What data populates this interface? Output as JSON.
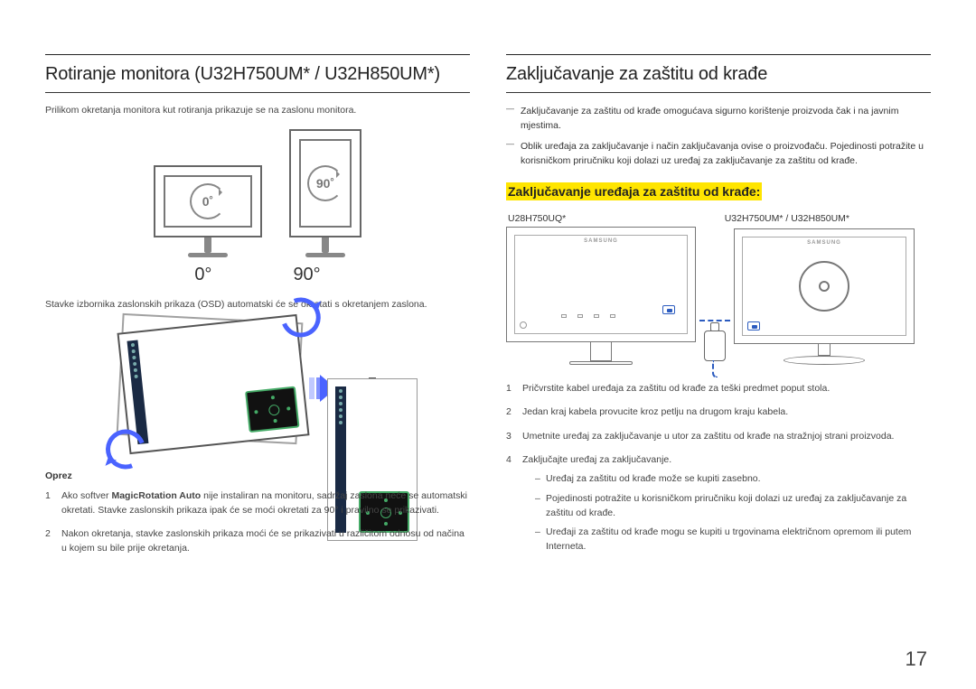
{
  "page_number": "17",
  "left": {
    "heading": "Rotiranje monitora (U32H750UM* / U32H850UM*)",
    "intro": "Prilikom okretanja monitora kut rotiranja prikazuje se na zaslonu monitora.",
    "angle_a_badge": "0˚",
    "angle_b_badge": "90˚",
    "angle_a_label": "0°",
    "angle_b_label": "90°",
    "osd_note": "Stavke izbornika zaslonskih prikaza (OSD) automatski će se okretati s okretanjem zaslona.",
    "caution_label": "Oprez",
    "caution_items": [
      {
        "pre": "Ako softver ",
        "bold": "MagicRotation Auto",
        "post": " nije instaliran na monitoru, sadržaj zaslona neće se automatski okretati. Stavke zaslonskih prikaza ipak će se moći okretati za 90° i pravilno se prikazivati."
      },
      {
        "pre": "Nakon okretanja, stavke zaslonskih prikaza moći će se prikazivati u različitom odnosu od načina u kojem su bile prije okretanja.",
        "bold": "",
        "post": ""
      }
    ]
  },
  "right": {
    "heading": "Zaključavanje za zaštitu od krađe",
    "notes": [
      "Zaključavanje za zaštitu od krađe omogućava sigurno korištenje proizvoda čak i na javnim mjestima.",
      "Oblik uređaja za zaključavanje i način zaključavanja ovise o proizvođaču. Pojedinosti potražite u korisničkom priručniku koji dolazi uz uređaj za zaključavanje za zaštitu od krađe."
    ],
    "subheading": "Zaključavanje uređaja za zaštitu od krađe:",
    "model_a": "U28H750UQ*",
    "model_b": "U32H750UM* / U32H850UM*",
    "brand": "SAMSUNG",
    "steps": [
      "Pričvrstite kabel uređaja za zaštitu od krađe za teški predmet poput stola.",
      "Jedan kraj kabela provucite kroz petlju na drugom kraju kabela.",
      "Umetnite uređaj za zaključavanje u utor za zaštitu od krađe na stražnjoj strani proizvoda.",
      "Zaključajte uređaj za zaključavanje."
    ],
    "sub_bullets": [
      "Uređaj za zaštitu od krađe može se kupiti zasebno.",
      "Pojedinosti potražite u korisničkom priručniku koji dolazi uz uređaj za zaključavanje za zaštitu od krađe.",
      "Uređaji za zaštitu od krađe mogu se kupiti u trgovinama električnom opremom ili putem Interneta."
    ]
  }
}
